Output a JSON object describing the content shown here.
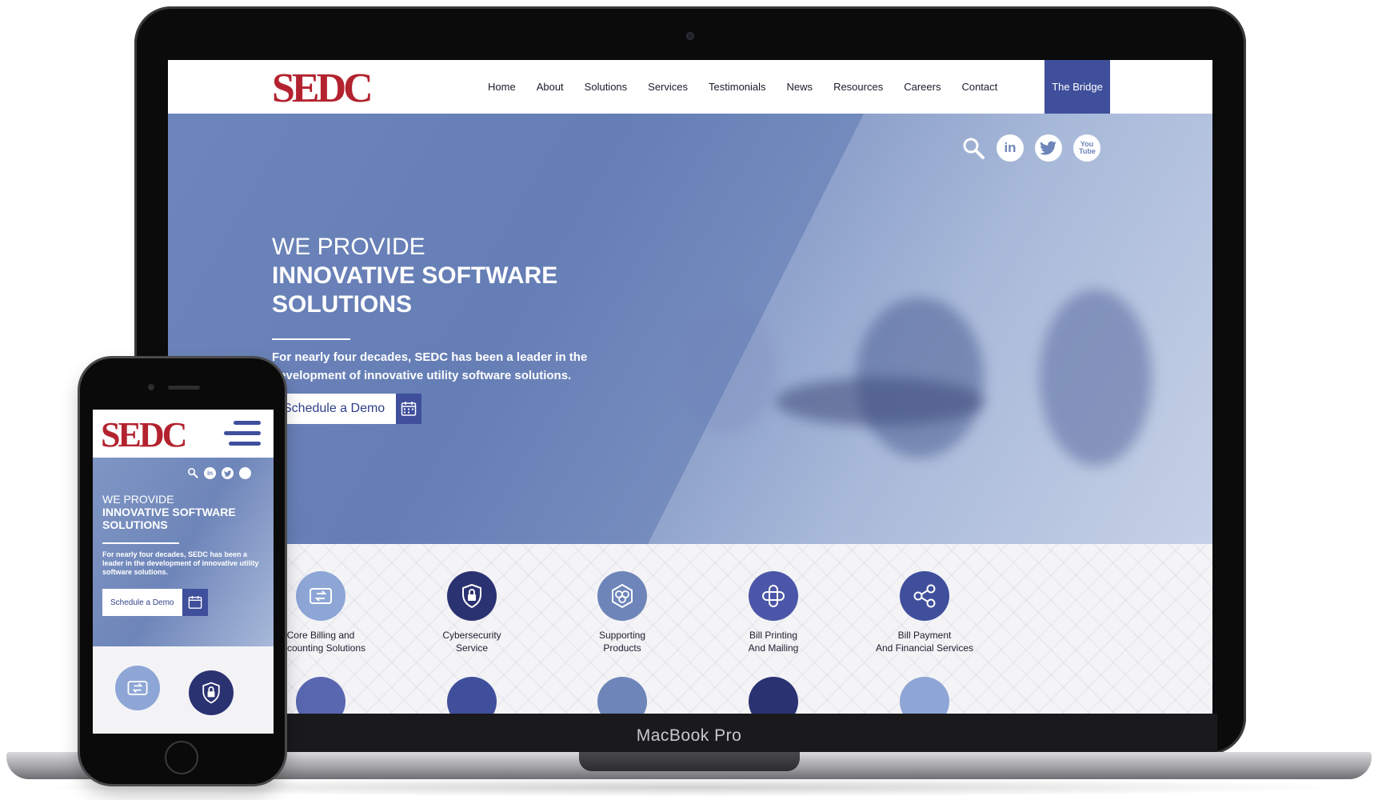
{
  "colors": {
    "brand_red": "#b3232f",
    "brand_blue": "#3f4f9c",
    "light_blue": "#8ea6d6",
    "navy": "#2b3272",
    "hero_blue": "#6e85b9"
  },
  "logo": {
    "text": "SEDC"
  },
  "nav": {
    "items": [
      "Home",
      "About",
      "Solutions",
      "Services",
      "Testimonials",
      "News",
      "Resources",
      "Careers",
      "Contact"
    ],
    "cta": "The Bridge"
  },
  "social": {
    "icons": [
      "search-icon",
      "linkedin-icon",
      "twitter-icon",
      "youtube-icon"
    ],
    "linkedin_text": "in",
    "youtube_text": "You Tube"
  },
  "hero": {
    "kicker": "WE PROVIDE",
    "title": "INNOVATIVE SOFTWARE SOLUTIONS",
    "text": "For nearly four decades, SEDC has been a leader in the development of innovative utility software solutions.",
    "button": "Schedule a Demo"
  },
  "services": [
    {
      "label_1": "Core Billing and",
      "label_2": "Accounting Solutions",
      "icon": "billing-icon"
    },
    {
      "label_1": "Cybersecurity",
      "label_2": "Service",
      "icon": "lock-icon"
    },
    {
      "label_1": "Supporting",
      "label_2": "Products",
      "icon": "hexagon-icon"
    },
    {
      "label_1": "Bill Printing",
      "label_2": "And Mailing",
      "icon": "printing-icon"
    },
    {
      "label_1": "Bill Payment",
      "label_2": "And Financial Services",
      "icon": "share-icon"
    }
  ],
  "services_row2_icons": [
    "people-icon",
    "diamond-icon",
    "chart-icon",
    "drop-icon",
    "network-icon"
  ],
  "device": {
    "laptop_brand": "MacBook Pro"
  }
}
